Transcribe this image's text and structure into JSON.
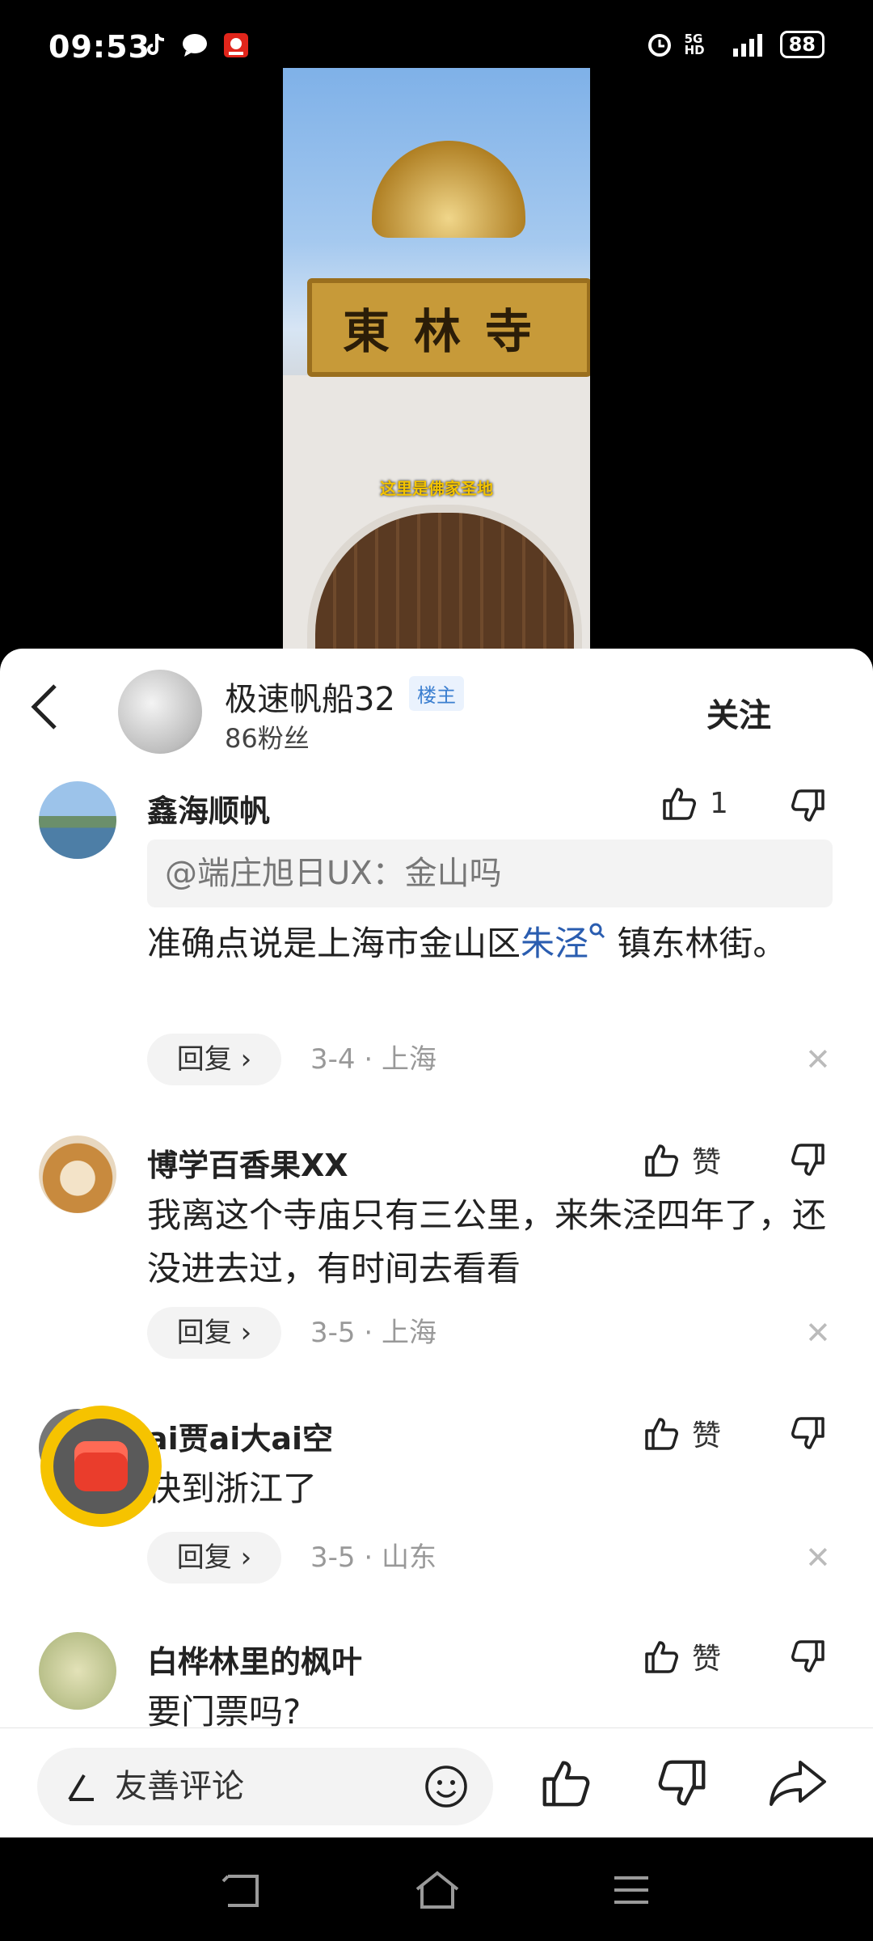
{
  "status": {
    "time": "09:53",
    "battery": "88",
    "network": "5G HD"
  },
  "video": {
    "plaque": "東林寺",
    "caption": "这里是佛家圣地"
  },
  "author": {
    "name": "极速帆船32",
    "badge": "楼主",
    "fans": "86粉丝",
    "follow": "关注"
  },
  "comments": [
    {
      "name": "鑫海顺帆",
      "likes": "1",
      "quote": "@端庄旭日UX：金山吗",
      "text_before": "准确点说是上海市金山区",
      "text_link": "朱泾",
      "text_after": " 镇东林街。",
      "reply": "回复",
      "meta": "3-4 · 上海"
    },
    {
      "name": "博学百香果XX",
      "likes": "赞",
      "text": "我离这个寺庙只有三公里，来朱泾四年了，还没进去过，有时间去看看",
      "reply": "回复",
      "meta": "3-5 · 上海"
    },
    {
      "name": "ai贾ai大ai空",
      "likes": "赞",
      "text": "快到浙江了",
      "reply": "回复",
      "meta": "3-5 · 山东"
    },
    {
      "name": "白桦林里的枫叶",
      "likes": "赞",
      "text": "要门票吗?"
    }
  ],
  "input": {
    "placeholder": "友善评论"
  }
}
